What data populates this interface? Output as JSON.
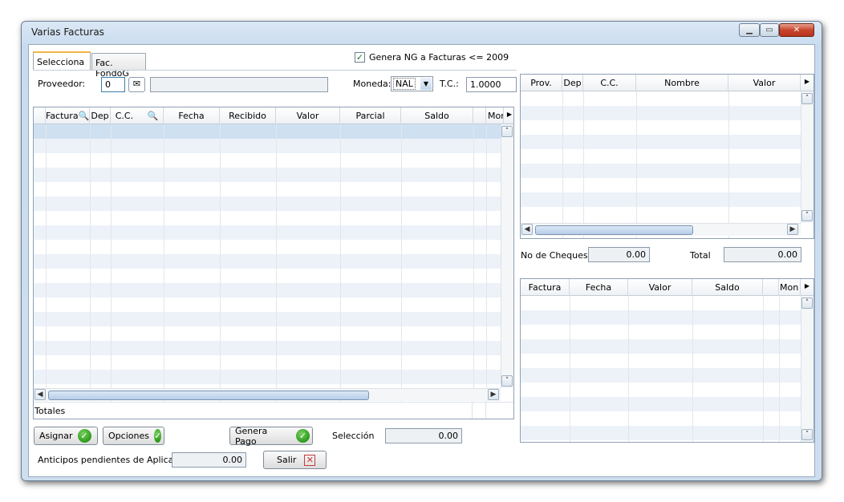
{
  "window": {
    "title": "Varias Facturas"
  },
  "tabs": [
    {
      "label": "Selecciona"
    },
    {
      "label": "Fac. FondoG"
    }
  ],
  "genera_ng": {
    "checked": true,
    "label": "Genera NG a Facturas <= 2009"
  },
  "proveedor": {
    "label": "Proveedor:",
    "code": "0",
    "name": ""
  },
  "moneda": {
    "label": "Moneda:",
    "value": "NAL"
  },
  "tc": {
    "label": "T.C.:",
    "value": "1.0000"
  },
  "main_grid": {
    "columns": [
      "Factura",
      "Dep",
      "C.C.",
      "Fecha",
      "Recibido",
      "Valor",
      "Parcial",
      "Saldo",
      "Mon"
    ],
    "totals_label": "Totales"
  },
  "cheques_grid": {
    "columns": [
      "Prov.",
      "Dep",
      "C.C.",
      "Nombre",
      "Valor"
    ]
  },
  "no_cheques": {
    "label": "No de Cheques",
    "value": "0.00"
  },
  "total": {
    "label": "Total",
    "value": "0.00"
  },
  "facturas_grid": {
    "columns": [
      "Factura",
      "Fecha",
      "Valor",
      "Saldo",
      "Mon"
    ]
  },
  "buttons": {
    "asignar": "Asignar",
    "opciones": "Opciones",
    "genera_pago": "Genera Pago",
    "salir": "Salir"
  },
  "seleccion": {
    "label": "Selección",
    "value": "0.00"
  },
  "anticipos": {
    "label": "Anticipos pendientes de Aplicar",
    "value": "0.00"
  },
  "icons": {
    "search": "search-icon",
    "ok": "ok-icon",
    "close": "close-icon"
  },
  "colors": {
    "accent_tab": "#f0b643",
    "ok_green": "#2b9a19",
    "alt_row": "#edf2f9",
    "selected_row": "#cfe0f1"
  }
}
